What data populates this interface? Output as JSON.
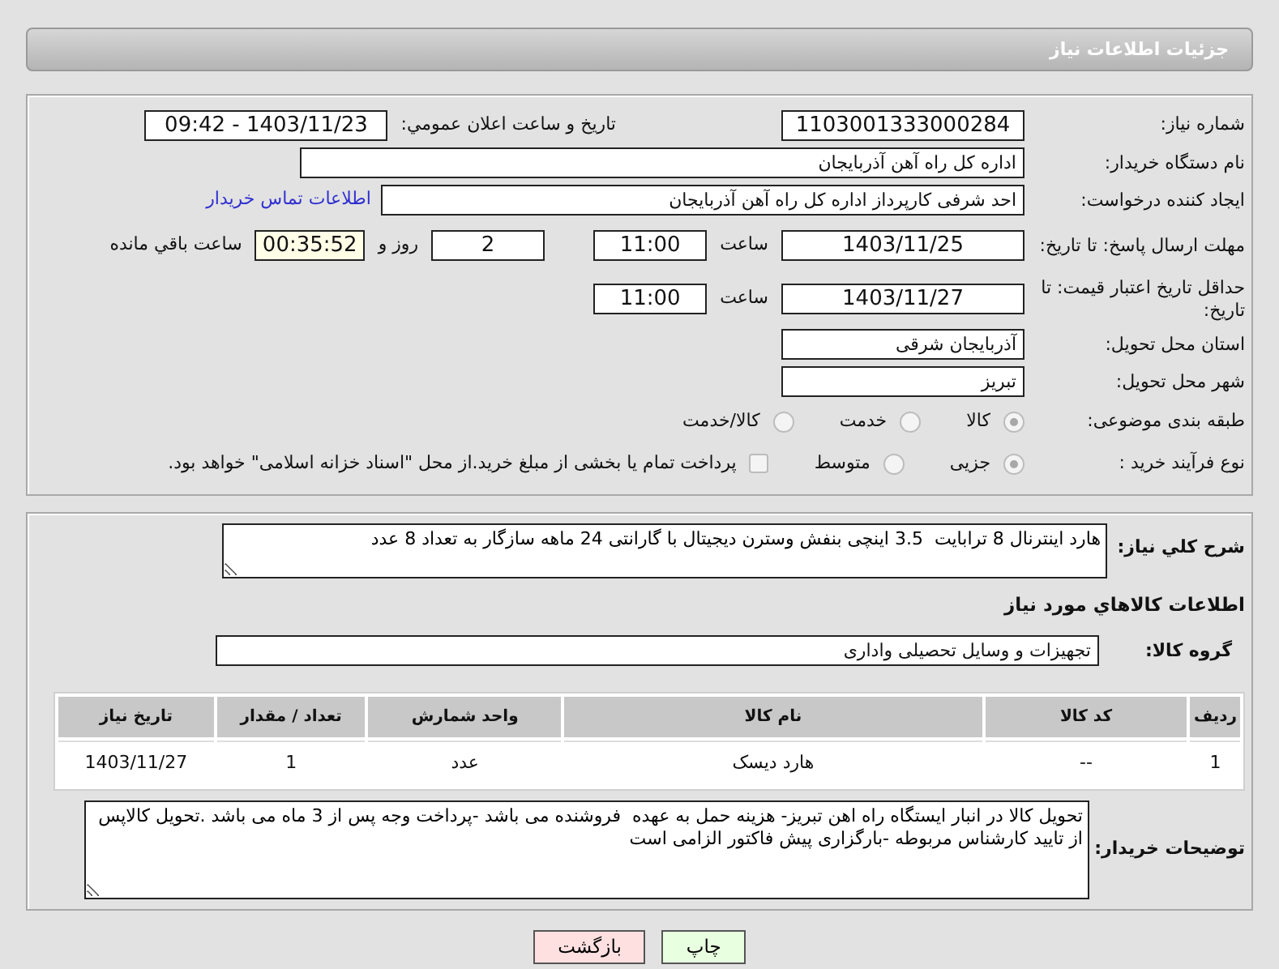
{
  "header": {
    "title": "جزئیات اطلاعات نیاز"
  },
  "need_number": {
    "label": "شماره نیاز:",
    "value": "1103001333000284"
  },
  "announce": {
    "label": "تاریخ و ساعت اعلان عمومي:",
    "value": "1403/11/23 - 09:42"
  },
  "buyer_org": {
    "label": "نام دستگاه خریدار:",
    "value": "اداره کل راه آهن آذربایجان"
  },
  "requester": {
    "label": "ایجاد کننده درخواست:",
    "value": "احد شرفی کارپرداز اداره کل راه آهن آذربایجان",
    "link": "اطلاعات تماس خریدار"
  },
  "reply_deadline": {
    "label": "مهلت ارسال پاسخ: تا تاریخ:",
    "date": "1403/11/25",
    "time_label": "ساعت",
    "time": "11:00",
    "days": "2",
    "days_label": "روز و",
    "remaining": "00:35:52",
    "remaining_label": "ساعت باقي مانده"
  },
  "price_validity": {
    "label": "حداقل تاریخ اعتبار قیمت: تا تاریخ:",
    "date": "1403/11/27",
    "time_label": "ساعت",
    "time": "11:00"
  },
  "province": {
    "label": "استان محل تحویل:",
    "value": "آذربایجان شرقی"
  },
  "city": {
    "label": "شهر محل تحویل:",
    "value": "تبریز"
  },
  "category": {
    "label": "طبقه بندی موضوعی:",
    "options": [
      {
        "label": "کالا",
        "selected": true
      },
      {
        "label": "خدمت",
        "selected": false
      },
      {
        "label": "کالا/خدمت",
        "selected": false
      }
    ]
  },
  "process": {
    "label": "نوع فرآیند خرید :",
    "options": [
      {
        "label": "جزیی",
        "selected": true
      },
      {
        "label": "متوسط",
        "selected": false
      }
    ],
    "payment": {
      "label": "پرداخت تمام یا بخشی از مبلغ خرید.از محل \"اسناد خزانه اسلامی\" خواهد بود.",
      "checked": false
    }
  },
  "description": {
    "label": "شرح کلي نياز:",
    "value": "هارد اینترنال 8 ترابایت  3.5 اینچی بنفش وسترن دیجیتال با گارانتی 24 ماهه سازگار به تعداد 8 عدد"
  },
  "goods_title": "اطلاعات کالاهاي مورد نياز",
  "goods_group": {
    "label": "گروه کالا:",
    "value": "تجهیزات و وسایل تحصیلی واداری"
  },
  "table": {
    "columns": [
      "ردیف",
      "کد کالا",
      "نام کالا",
      "واحد شمارش",
      "تعداد / مقدار",
      "تاریخ نیاز"
    ],
    "rows": [
      [
        "1",
        "--",
        "هارد دیسک",
        "عدد",
        "1",
        "1403/11/27"
      ]
    ]
  },
  "notes": {
    "label": "توضیحات خریدار:",
    "value": "تحویل کالا در انبار ایستگاه راه اهن تبریز- هزینه حمل به عهده  فروشنده می باشد -پرداخت وجه پس از 3 ماه می باشد .تحویل کالاپس از تایید کارشناس مربوطه -بارگزاری پیش فاکتور الزامی است"
  },
  "buttons": [
    {
      "label": "چاپ",
      "kind": "print"
    },
    {
      "label": "بازگشت",
      "kind": "back"
    }
  ]
}
